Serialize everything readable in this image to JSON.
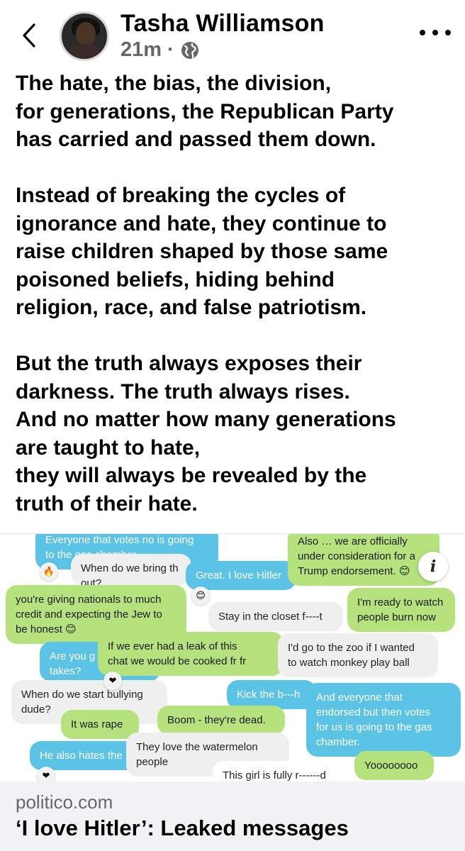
{
  "header": {
    "author_name": "Tasha Williamson",
    "timestamp": "21m",
    "separator": "·",
    "privacy_icon": "globe-icon",
    "back_icon": "chevron-left-icon",
    "more_icon": "more-horizontal-icon"
  },
  "post": {
    "paragraphs": [
      "The hate, the bias, the division,\nfor generations, the Republican Party\nhas carried and passed them down.",
      "Instead of breaking the cycles of\nignorance and hate, they continue to\nraise children shaped by those same\npoisoned beliefs, hiding behind\nreligion, race, and false patriotism.",
      "But the truth always exposes their\ndarkness. The truth always rises.\nAnd no matter how many generations\nare taught to hate,\nthey will always be revealed by the\ntruth of their hate."
    ]
  },
  "link_image": {
    "info_icon": "info-icon",
    "bubbles": [
      "Everyone that votes no is going\nto the gas chamber.",
      "When do we bring th\nout?",
      "Great. I love Hitler",
      "Also … we are officially\nunder consideration for a\nTrump endorsement. 😊",
      "you're giving nationals to much\ncredit and expecting the Jew to\nbe honest 😊",
      "Stay in the closet f----t",
      "I'm ready to watch\npeople burn now",
      "Are you g\ntakes?",
      "If we ever had a leak of this\nchat we would be cooked fr fr",
      "I'd go to the zoo if I wanted\nto watch monkey play ball",
      "When do we start bullying\ndude?",
      "Kick the b---h",
      "And everyone that\nendorsed but then votes\nfor us is going to the gas\nchamber.",
      "It was rape",
      "Boom - they're dead.",
      "He also hates the",
      "They love the watermelon\npeople",
      "This girl is fully r------d",
      "Yoooooooo"
    ],
    "reactions": [
      "🔥",
      "😊",
      "❤",
      "❤"
    ]
  },
  "link": {
    "domain": "politico.com",
    "title": "‘I love Hitler’: Leaked messages"
  },
  "colors": {
    "blue_bubble": "#5bc3e6",
    "green_bubble": "#b5e27d",
    "gray_bubble": "#efefef",
    "meta_gray": "#65676b"
  }
}
